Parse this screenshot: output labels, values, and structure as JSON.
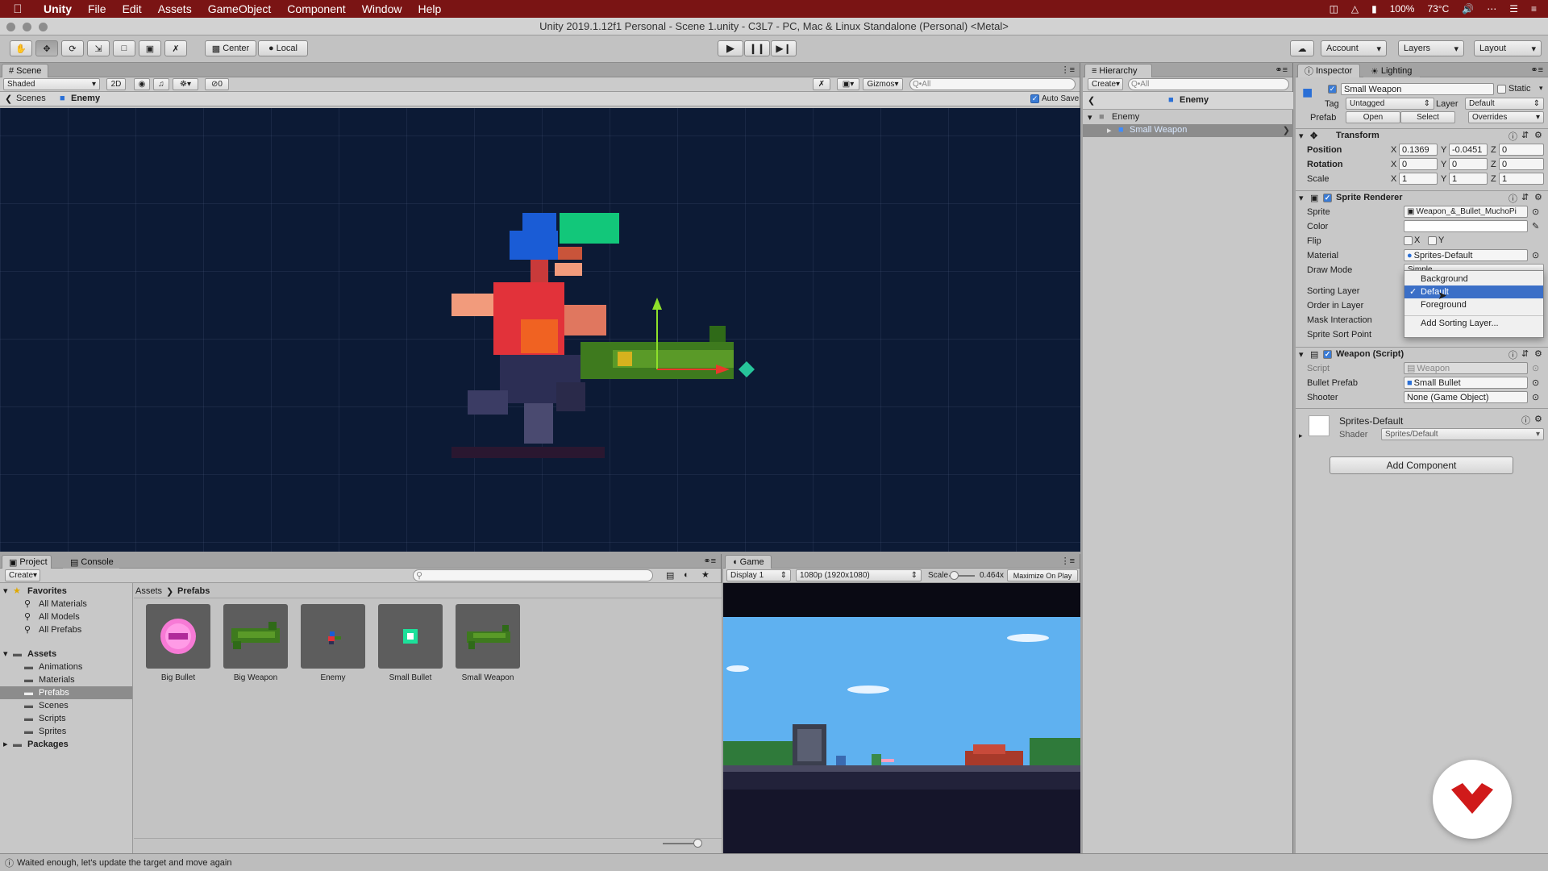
{
  "menubar": {
    "app": "Unity",
    "items": [
      "File",
      "Edit",
      "Assets",
      "GameObject",
      "Component",
      "Window",
      "Help"
    ],
    "battery": "100%",
    "temp": "73°C"
  },
  "window_title": "Unity 2019.1.12f1 Personal - Scene 1.unity - C3L7 - PC, Mac & Linux Standalone (Personal) <Metal>",
  "toolbar": {
    "pivot": "Center",
    "space": "Local",
    "account": "Account",
    "layers": "Layers",
    "layout": "Layout"
  },
  "scene": {
    "tab": "Scene",
    "shading": "Shaded",
    "mode2d": "2D",
    "fx_count": "0",
    "gizmos": "Gizmos",
    "search_placeholder": "Q•All",
    "crumb_root": "Scenes",
    "crumb_obj": "Enemy",
    "auto_save": "Auto Save"
  },
  "hierarchy": {
    "tab": "Hierarchy",
    "create": "Create",
    "search_placeholder": "Q•All",
    "header": "Enemy",
    "rows": [
      "Enemy",
      "Small Weapon"
    ]
  },
  "inspector": {
    "tab": "Inspector",
    "tab2": "Lighting",
    "object_name": "Small Weapon",
    "static_label": "Static",
    "tag_label": "Tag",
    "tag": "Untagged",
    "layer_label": "Layer",
    "layer": "Default",
    "prefab_label": "Prefab",
    "open": "Open",
    "select": "Select",
    "overrides": "Overrides",
    "transform": {
      "title": "Transform",
      "rows": [
        {
          "label": "Position",
          "x": "0.1369",
          "y": "-0.0451",
          "z": "0"
        },
        {
          "label": "Rotation",
          "x": "0",
          "y": "0",
          "z": "0"
        },
        {
          "label": "Scale",
          "x": "1",
          "y": "1",
          "z": "1"
        }
      ]
    },
    "sprite_renderer": {
      "title": "Sprite Renderer",
      "sprite_label": "Sprite",
      "sprite": "Weapon_&_Bullet_MuchoPi",
      "color_label": "Color",
      "flip_label": "Flip",
      "flip_x": "X",
      "flip_y": "Y",
      "material_label": "Material",
      "material": "Sprites-Default",
      "draw_mode_label": "Draw Mode",
      "draw_mode": "Simple",
      "sorting_layer_label": "Sorting Layer",
      "order_label": "Order in Layer",
      "mask_label": "Mask Interaction",
      "sort_point_label": "Sprite Sort Point"
    },
    "sorting_menu": {
      "items": [
        "Background",
        "Default",
        "Foreground"
      ],
      "add": "Add Sorting Layer...",
      "checked": "Default"
    },
    "weapon": {
      "title": "Weapon (Script)",
      "script_label": "Script",
      "script": "Weapon",
      "bullet_label": "Bullet Prefab",
      "bullet": "Small Bullet",
      "shooter_label": "Shooter",
      "shooter": "None (Game Object)"
    },
    "material_section": {
      "name": "Sprites-Default",
      "shader_label": "Shader",
      "shader": "Sprites/Default"
    },
    "add_component": "Add Component"
  },
  "project": {
    "tab": "Project",
    "tab2": "Console",
    "create": "Create",
    "crumb": [
      "Assets",
      "Prefabs"
    ],
    "favorites": {
      "title": "Favorites",
      "items": [
        "All Materials",
        "All Models",
        "All Prefabs"
      ]
    },
    "assets": {
      "title": "Assets",
      "items": [
        "Animations",
        "Materials",
        "Prefabs",
        "Scenes",
        "Scripts",
        "Sprites"
      ]
    },
    "packages": "Packages",
    "prefabs": [
      "Big Bullet",
      "Big Weapon",
      "Enemy",
      "Small Bullet",
      "Small Weapon"
    ]
  },
  "game": {
    "tab": "Game",
    "display": "Display 1",
    "resolution": "1080p (1920x1080)",
    "scale_label": "Scale",
    "scale": "0.464x",
    "maximize": "Maximize On Play"
  },
  "status": "Waited enough, let's update the target and move again",
  "colors": {
    "menubar": "#7a1414",
    "scene_bg": "#0c1a35",
    "selection": "#8c8c8c",
    "sky": "#5fb1f0"
  }
}
